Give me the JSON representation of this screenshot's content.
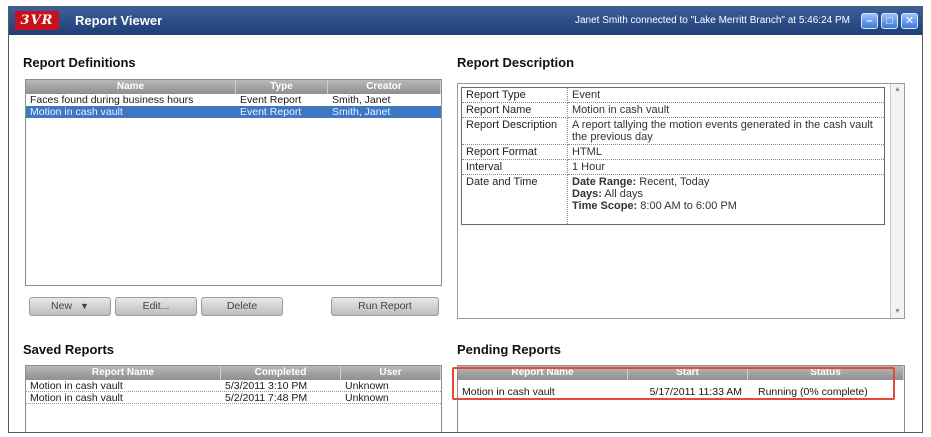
{
  "window": {
    "logo_text": "3VR",
    "title": "Report Viewer",
    "connection_status": "Janet Smith connected to \"Lake Merritt Branch\" at 5:46:24 PM",
    "controls": {
      "minimize": "–",
      "maximize": "□",
      "close": "✕"
    }
  },
  "report_definitions": {
    "title": "Report Definitions",
    "columns": [
      "Name",
      "Type",
      "Creator"
    ],
    "rows": [
      {
        "name": "Faces found during business hours",
        "type": "Event Report",
        "creator": "Smith, Janet",
        "selected": false
      },
      {
        "name": "Motion in cash vault",
        "type": "Event Report",
        "creator": "Smith, Janet",
        "selected": true
      }
    ],
    "buttons": {
      "new": "New",
      "edit": "Edit...",
      "delete": "Delete",
      "run": "Run Report"
    }
  },
  "report_description": {
    "title": "Report Description",
    "rows": [
      {
        "key": "Report Type",
        "value": "Event"
      },
      {
        "key": "Report Name",
        "value": "Motion in cash vault"
      },
      {
        "key": "Report Description",
        "value": "A report tallying the motion events generated in the cash vault the previous day"
      },
      {
        "key": "Report Format",
        "value": "HTML"
      },
      {
        "key": "Interval",
        "value": "1 Hour"
      }
    ],
    "date_time": {
      "key": "Date and Time",
      "date_range_label": "Date Range:",
      "date_range_value": "Recent, Today",
      "days_label": "Days:",
      "days_value": "All days",
      "time_scope_label": "Time Scope:",
      "time_scope_value": "8:00 AM to 6:00 PM"
    }
  },
  "saved_reports": {
    "title": "Saved Reports",
    "columns": [
      "Report Name",
      "Completed",
      "User"
    ],
    "rows": [
      {
        "name": "Motion in cash vault",
        "completed": "5/3/2011 3:10 PM",
        "user": "Unknown"
      },
      {
        "name": "Motion in cash vault",
        "completed": "5/2/2011 7:48 PM",
        "user": "Unknown"
      }
    ]
  },
  "pending_reports": {
    "title": "Pending Reports",
    "columns": [
      "Report Name",
      "Start",
      "Status"
    ],
    "rows": [
      {
        "name": "Motion in cash vault",
        "start": "5/17/2011 11:33 AM",
        "status": "Running (0% complete)"
      }
    ]
  },
  "colors": {
    "titlebar": "#2b4c86",
    "selection": "#3f78c2",
    "highlight": "#e24a3a",
    "logo": "#c8101e"
  }
}
